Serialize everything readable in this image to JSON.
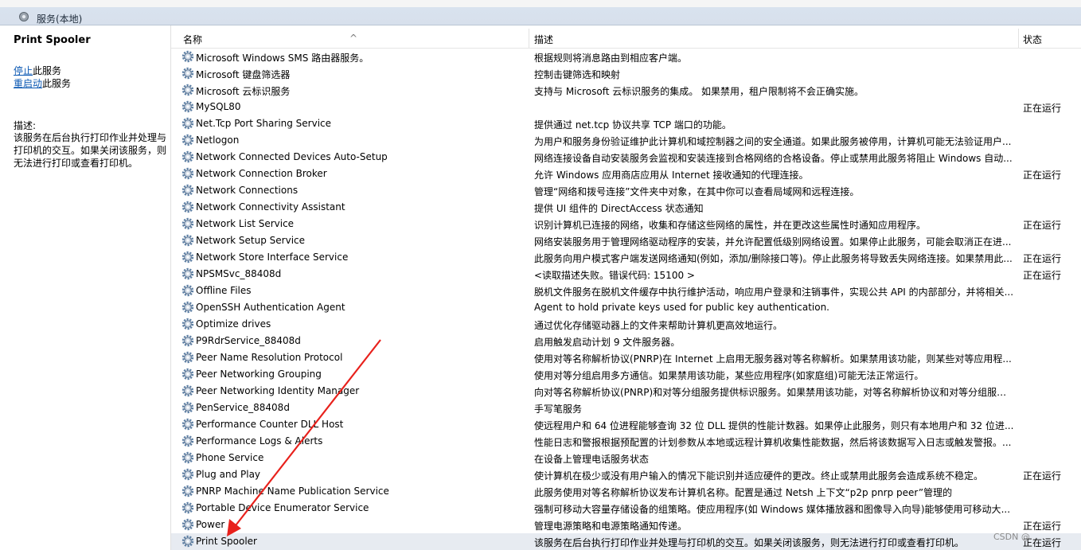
{
  "window": {
    "title": "服务(本地)",
    "icon": "services-gear-icon"
  },
  "left": {
    "service_title": "Print Spooler",
    "stop_link": "停止",
    "stop_suffix": "此服务",
    "restart_link": "重启动",
    "restart_suffix": "此服务",
    "desc_label": "描述:",
    "desc_text": "该服务在后台执行打印作业并处理与打印机的交互。如果关闭该服务，则无法进行打印或查看打印机。"
  },
  "columns": {
    "name": "名称",
    "desc": "描述",
    "status": "状态"
  },
  "colors": {
    "selected_row": "#e7ebf1",
    "link": "#0b58b3",
    "annotation_arrow": "#e8211c"
  },
  "rows": [
    {
      "name": "Microsoft Windows SMS 路由器服务。",
      "desc": "根据规则将消息路由到相应客户端。",
      "status": ""
    },
    {
      "name": "Microsoft 键盘筛选器",
      "desc": "控制击键筛选和映射",
      "status": ""
    },
    {
      "name": "Microsoft 云标识服务",
      "desc": "支持与 Microsoft 云标识服务的集成。 如果禁用，租户限制将不会正确实施。",
      "status": ""
    },
    {
      "name": "MySQL80",
      "desc": "",
      "status": "正在运行"
    },
    {
      "name": "Net.Tcp Port Sharing Service",
      "desc": "提供通过 net.tcp 协议共享 TCP 端口的功能。",
      "status": ""
    },
    {
      "name": "Netlogon",
      "desc": "为用户和服务身份验证维护此计算机和域控制器之间的安全通道。如果此服务被停用，计算机可能无法验证用户...",
      "status": ""
    },
    {
      "name": "Network Connected Devices Auto-Setup",
      "desc": "网络连接设备自动安装服务会监视和安装连接到合格网络的合格设备。停止或禁用此服务将阻止 Windows 自动...",
      "status": ""
    },
    {
      "name": "Network Connection Broker",
      "desc": "允许 Windows 应用商店应用从 Internet 接收通知的代理连接。",
      "status": "正在运行"
    },
    {
      "name": "Network Connections",
      "desc": "管理“网络和拨号连接”文件夹中对象，在其中你可以查看局域网和远程连接。",
      "status": ""
    },
    {
      "name": "Network Connectivity Assistant",
      "desc": "提供 UI 组件的 DirectAccess 状态通知",
      "status": ""
    },
    {
      "name": "Network List Service",
      "desc": "识别计算机已连接的网络，收集和存储这些网络的属性，并在更改这些属性时通知应用程序。",
      "status": "正在运行"
    },
    {
      "name": "Network Setup Service",
      "desc": "网络安装服务用于管理网络驱动程序的安装，并允许配置低级别网络设置。如果停止此服务，可能会取消正在进...",
      "status": ""
    },
    {
      "name": "Network Store Interface Service",
      "desc": "此服务向用户模式客户端发送网络通知(例如，添加/删除接口等)。停止此服务将导致丢失网络连接。如果禁用此...",
      "status": "正在运行"
    },
    {
      "name": "NPSMSvc_88408d",
      "desc": "<读取描述失败。错误代码: 15100 >",
      "status": "正在运行"
    },
    {
      "name": "Offline Files",
      "desc": "脱机文件服务在脱机文件缓存中执行维护活动，响应用户登录和注销事件，实现公共 API 的内部部分，并将相关...",
      "status": ""
    },
    {
      "name": "OpenSSH Authentication Agent",
      "desc": "Agent to hold private keys used for public key authentication.",
      "status": ""
    },
    {
      "name": "Optimize drives",
      "desc": "通过优化存储驱动器上的文件来帮助计算机更高效地运行。",
      "status": ""
    },
    {
      "name": "P9RdrService_88408d",
      "desc": "启用触发启动计划 9 文件服务器。",
      "status": ""
    },
    {
      "name": "Peer Name Resolution Protocol",
      "desc": "使用对等名称解析协议(PNRP)在 Internet 上启用无服务器对等名称解析。如果禁用该功能，则某些对等应用程...",
      "status": ""
    },
    {
      "name": "Peer Networking Grouping",
      "desc": "使用对等分组启用多方通信。如果禁用该功能，某些应用程序(如家庭组)可能无法正常运行。",
      "status": ""
    },
    {
      "name": "Peer Networking Identity Manager",
      "desc": "向对等名称解析协议(PNRP)和对等分组服务提供标识服务。如果禁用该功能，对等名称解析协议和对等分组服务...",
      "status": ""
    },
    {
      "name": "PenService_88408d",
      "desc": "手写笔服务",
      "status": ""
    },
    {
      "name": "Performance Counter DLL Host",
      "desc": "使远程用户和 64 位进程能够查询 32 位 DLL 提供的性能计数器。如果停止此服务，则只有本地用户和 32 位进...",
      "status": ""
    },
    {
      "name": "Performance Logs & Alerts",
      "desc": "性能日志和警报根据预配置的计划参数从本地或远程计算机收集性能数据，然后将该数据写入日志或触发警报。...",
      "status": ""
    },
    {
      "name": "Phone Service",
      "desc": "在设备上管理电话服务状态",
      "status": ""
    },
    {
      "name": "Plug and Play",
      "desc": "使计算机在极少或没有用户输入的情况下能识别并适应硬件的更改。终止或禁用此服务会造成系统不稳定。",
      "status": "正在运行"
    },
    {
      "name": "PNRP Machine Name Publication Service",
      "desc": "此服务使用对等名称解析协议发布计算机名称。配置是通过 Netsh 上下文“p2p pnrp peer”管理的",
      "status": ""
    },
    {
      "name": "Portable Device Enumerator Service",
      "desc": "强制可移动大容量存储设备的组策略。使应用程序(如 Windows 媒体播放器和图像导入向导)能够使用可移动大...",
      "status": ""
    },
    {
      "name": "Power",
      "desc": "管理电源策略和电源策略通知传递。",
      "status": "正在运行"
    },
    {
      "name": "Print Spooler",
      "desc": "该服务在后台执行打印作业并处理与打印机的交互。如果关闭该服务，则无法进行打印或查看打印机。",
      "status": "正在运行",
      "selected": true
    }
  ],
  "watermark": "CSDN @"
}
